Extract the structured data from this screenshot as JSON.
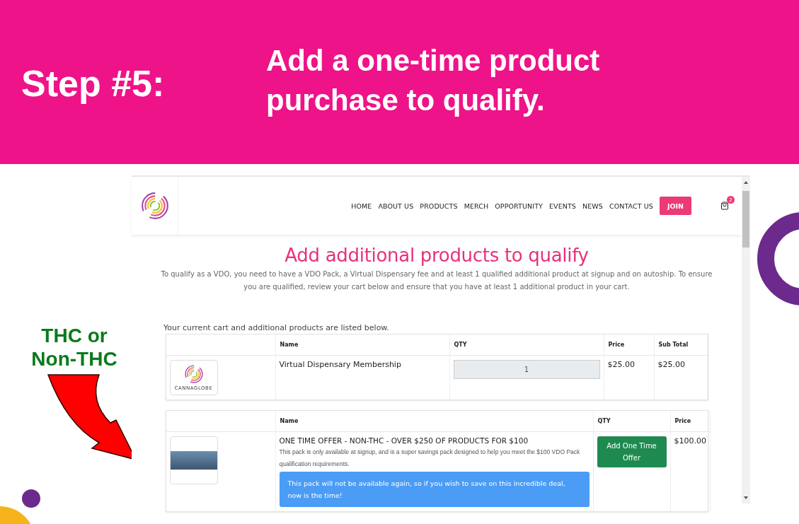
{
  "slide": {
    "step": "Step #5:",
    "headline": "Add a one-time product purchase to qualify.",
    "callout": "THC or Non-THC"
  },
  "site": {
    "nav": [
      "HOME",
      "ABOUT US",
      "PRODUCTS",
      "MERCH",
      "OPPORTUNITY",
      "EVENTS",
      "NEWS",
      "CONTACT US"
    ],
    "join": "JOIN",
    "cart_count": "2"
  },
  "page": {
    "heading": "Add additional products to qualify",
    "intro": "To qualify as a VDO, you need to have a VDO Pack, a Virtual Dispensary fee and at least 1 qualified additional product at signup and on autoship. To ensure you are qualified, review your cart below and ensure that you have at least 1 additional product in your cart.",
    "cart_caption": "Your current cart and additional products are listed below."
  },
  "cart_table": {
    "columns": [
      "Name",
      "QTY",
      "Price",
      "Sub Total"
    ],
    "rows": [
      {
        "brand": "CANNAGLOBE",
        "name": "Virtual Dispensary Membership",
        "qty": "1",
        "price": "$25.00",
        "subtotal": "$25.00"
      }
    ]
  },
  "offer_table": {
    "columns": [
      "Name",
      "QTY",
      "Price"
    ],
    "rows": [
      {
        "title": "ONE TIME OFFER - NON-THC - OVER $250 OF PRODUCTS FOR $100",
        "description": "This pack is only available at signup, and is a super savings pack designed to help you meet the $100 VDO Pack qualification requirements.",
        "notice": "This pack will not be available again, so if you wish to save on this incredible deal, now is the time!",
        "button": "Add One Time Offer",
        "price": "$100.00"
      }
    ]
  }
}
